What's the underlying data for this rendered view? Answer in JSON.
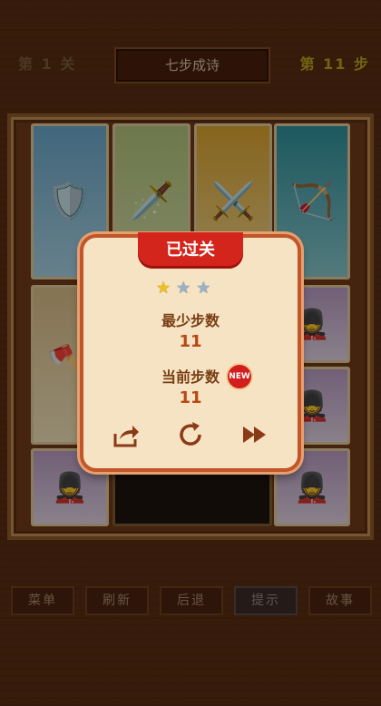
{
  "header": {
    "level_left": "第 1 关",
    "title": "七步成诗",
    "level_right": "第 11 步"
  },
  "board": {
    "tiles": [
      {
        "theme": "blue",
        "icon": "blue-warrior-icon",
        "glyph": "🛡️"
      },
      {
        "theme": "green",
        "icon": "green-general-icon",
        "glyph": "🗡️"
      },
      {
        "theme": "gold",
        "icon": "white-beard-general-icon",
        "glyph": "⚔️"
      },
      {
        "theme": "teal",
        "icon": "green-helmet-warrior-icon",
        "glyph": "🏹"
      },
      {
        "theme": "tan",
        "icon": "black-face-general-icon",
        "glyph": "🪓"
      },
      {
        "theme": "purple",
        "icon": "soldier-icon",
        "glyph": "💂"
      },
      {
        "theme": "purple",
        "icon": "soldier-icon",
        "glyph": "💂"
      },
      {
        "theme": "purple",
        "icon": "soldier-icon",
        "glyph": "💂"
      },
      {
        "theme": "purple",
        "icon": "soldier-icon",
        "glyph": "💂"
      }
    ]
  },
  "footer": {
    "buttons": [
      "菜单",
      "刷新",
      "后退",
      "提示",
      "故事"
    ]
  },
  "modal": {
    "ribbon": "已过关",
    "stars_earned": 1,
    "stars_total": 3,
    "min_steps_label": "最少步数",
    "min_steps_value": "11",
    "current_steps_label": "当前步数",
    "current_steps_value": "11",
    "new_badge": "NEW",
    "actions": [
      "share-icon",
      "replay-icon",
      "next-icon"
    ]
  },
  "colors": {
    "background": "#5a2e14",
    "ribbon": "#d4251c",
    "modal_bg": "#f6e3c3",
    "modal_border": "#c0562a",
    "label": "#7a3e14",
    "value": "#b84812"
  }
}
